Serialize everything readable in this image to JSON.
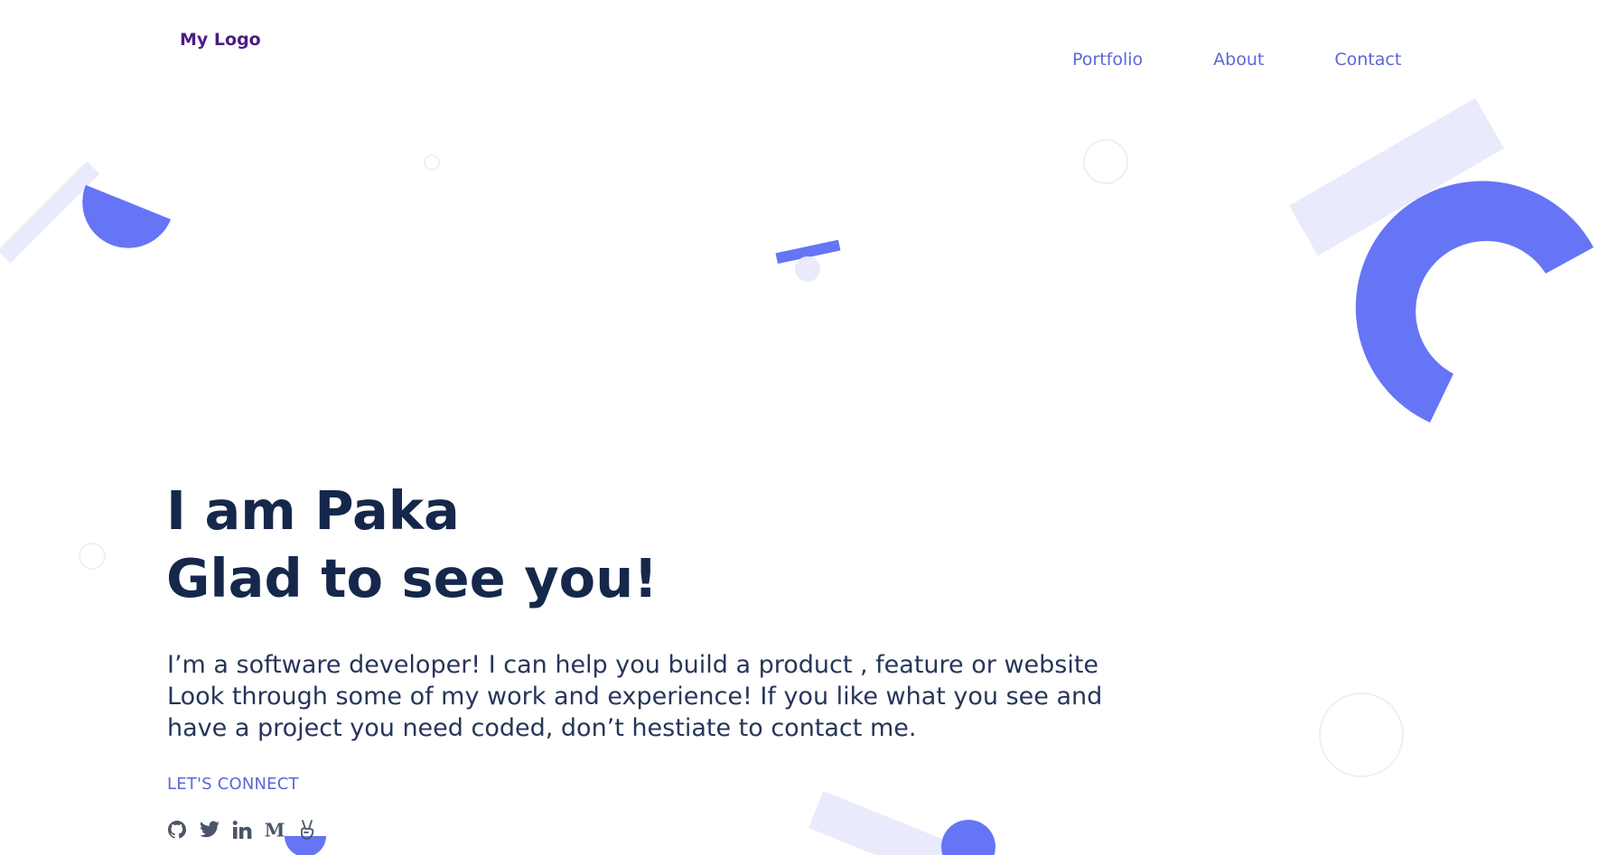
{
  "header": {
    "logo": "My Logo",
    "nav": [
      {
        "label": "Portfolio",
        "name": "nav-portfolio"
      },
      {
        "label": "About",
        "name": "nav-about"
      },
      {
        "label": "Contact",
        "name": "nav-contact"
      }
    ]
  },
  "hero": {
    "title_line1": "I am Paka",
    "title_line2": "Glad to see you!",
    "bio_line1": "I’m a software developer! I can help you build a product , feature or website",
    "bio_line2": "Look through some of my work and experience! If you like what you see and",
    "bio_line3": "have a project you need coded, don’t hestiate to contact me.",
    "connect_label": "LET'S CONNECT"
  },
  "socials": [
    {
      "icon": "github-icon"
    },
    {
      "icon": "twitter-icon"
    },
    {
      "icon": "linkedin-icon"
    },
    {
      "icon": "medium-icon"
    },
    {
      "icon": "angellist-icon"
    }
  ],
  "colors": {
    "accent": "#5a67d8",
    "shape_blue": "#6675f5",
    "shape_light": "#e9eafc",
    "heading": "#15284b",
    "logo": "#4b1d86"
  }
}
